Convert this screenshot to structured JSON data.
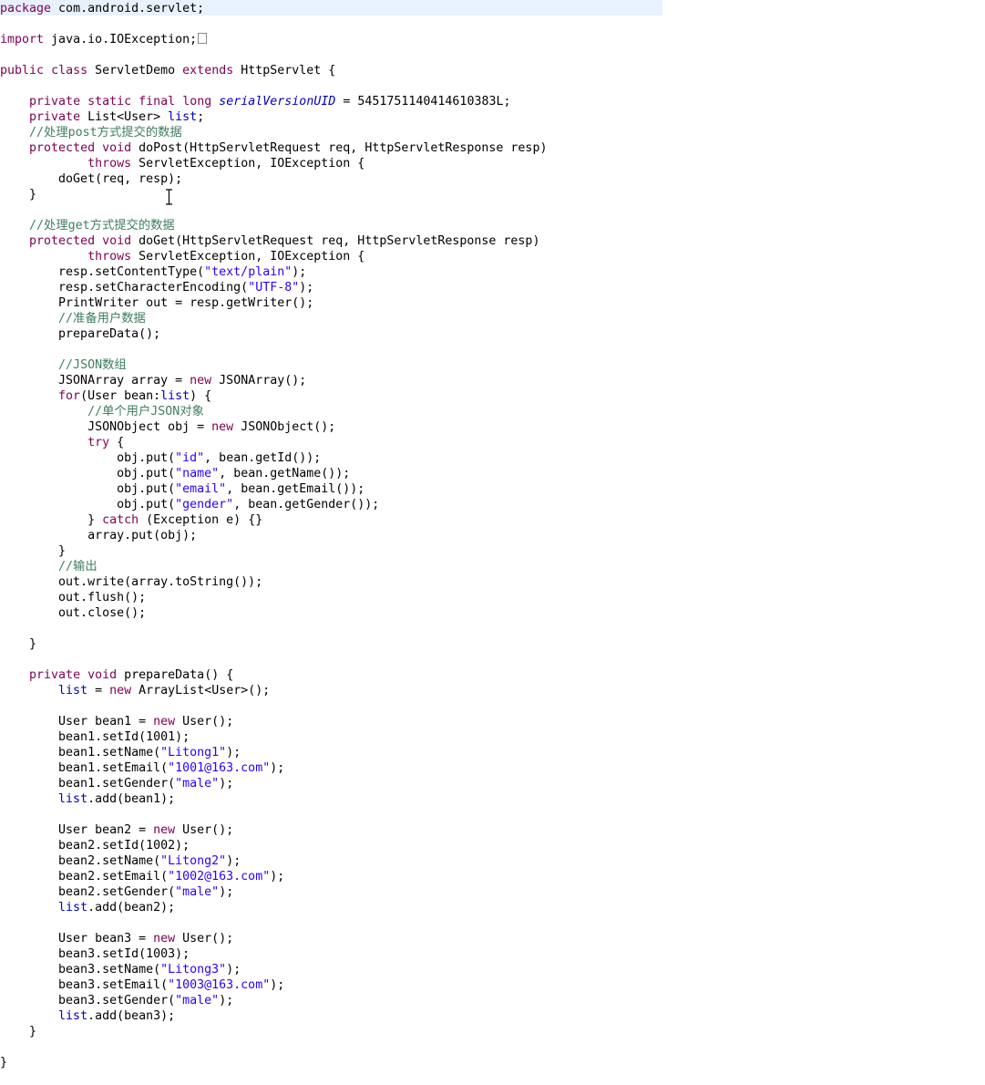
{
  "editor": {
    "lines": [
      [
        {
          "t": "package",
          "c": "kw"
        },
        {
          "t": " com.android.servlet;"
        }
      ],
      [],
      [
        {
          "t": "import",
          "c": "kw"
        },
        {
          "t": " java.io.IOException;"
        },
        {
          "fold": true
        }
      ],
      [],
      [
        {
          "t": "public",
          "c": "kw"
        },
        {
          "t": " "
        },
        {
          "t": "class",
          "c": "kw"
        },
        {
          "t": " ServletDemo "
        },
        {
          "t": "extends",
          "c": "kw"
        },
        {
          "t": " HttpServlet {"
        }
      ],
      [],
      [
        {
          "t": "    "
        },
        {
          "t": "private",
          "c": "kw"
        },
        {
          "t": " "
        },
        {
          "t": "static",
          "c": "kw"
        },
        {
          "t": " "
        },
        {
          "t": "final",
          "c": "kw"
        },
        {
          "t": " "
        },
        {
          "t": "long",
          "c": "kw"
        },
        {
          "t": " "
        },
        {
          "t": "serialVersionUID",
          "c": "field-italic"
        },
        {
          "t": " = 5451751140414610383L;"
        }
      ],
      [
        {
          "t": "    "
        },
        {
          "t": "private",
          "c": "kw"
        },
        {
          "t": " List<User> "
        },
        {
          "t": "list",
          "c": "field"
        },
        {
          "t": ";"
        }
      ],
      [
        {
          "t": "    "
        },
        {
          "t": "//处理post方式提交的数据",
          "c": "cm"
        }
      ],
      [
        {
          "t": "    "
        },
        {
          "t": "protected",
          "c": "kw"
        },
        {
          "t": " "
        },
        {
          "t": "void",
          "c": "kw"
        },
        {
          "t": " doPost(HttpServletRequest req, HttpServletResponse resp)"
        }
      ],
      [
        {
          "t": "            "
        },
        {
          "t": "throws",
          "c": "kw"
        },
        {
          "t": " ServletException, IOException {"
        }
      ],
      [
        {
          "t": "        doGet(req, resp);"
        }
      ],
      [
        {
          "t": "    }"
        }
      ],
      [],
      [
        {
          "t": "    "
        },
        {
          "t": "//处理get方式提交的数据",
          "c": "cm"
        }
      ],
      [
        {
          "t": "    "
        },
        {
          "t": "protected",
          "c": "kw"
        },
        {
          "t": " "
        },
        {
          "t": "void",
          "c": "kw"
        },
        {
          "t": " doGet(HttpServletRequest req, HttpServletResponse resp)"
        }
      ],
      [
        {
          "t": "            "
        },
        {
          "t": "throws",
          "c": "kw"
        },
        {
          "t": " ServletException, IOException {"
        }
      ],
      [
        {
          "t": "        resp.setContentType("
        },
        {
          "t": "\"text/plain\"",
          "c": "str"
        },
        {
          "t": ");"
        }
      ],
      [
        {
          "t": "        resp.setCharacterEncoding("
        },
        {
          "t": "\"UTF-8\"",
          "c": "str"
        },
        {
          "t": ");"
        }
      ],
      [
        {
          "t": "        PrintWriter out = resp.getWriter();"
        }
      ],
      [
        {
          "t": "        "
        },
        {
          "t": "//准备用户数据",
          "c": "cm"
        }
      ],
      [
        {
          "t": "        prepareData();"
        }
      ],
      [],
      [
        {
          "t": "        "
        },
        {
          "t": "//JSON数组",
          "c": "cm"
        }
      ],
      [
        {
          "t": "        JSONArray array = "
        },
        {
          "t": "new",
          "c": "kw"
        },
        {
          "t": " JSONArray();"
        }
      ],
      [
        {
          "t": "        "
        },
        {
          "t": "for",
          "c": "kw"
        },
        {
          "t": "(User bean:"
        },
        {
          "t": "list",
          "c": "field"
        },
        {
          "t": ") {"
        }
      ],
      [
        {
          "t": "            "
        },
        {
          "t": "//单个用户JSON对象",
          "c": "cm"
        }
      ],
      [
        {
          "t": "            JSONObject obj = "
        },
        {
          "t": "new",
          "c": "kw"
        },
        {
          "t": " JSONObject();"
        }
      ],
      [
        {
          "t": "            "
        },
        {
          "t": "try",
          "c": "kw"
        },
        {
          "t": " {"
        }
      ],
      [
        {
          "t": "                obj.put("
        },
        {
          "t": "\"id\"",
          "c": "str"
        },
        {
          "t": ", bean.getId());"
        }
      ],
      [
        {
          "t": "                obj.put("
        },
        {
          "t": "\"name\"",
          "c": "str"
        },
        {
          "t": ", bean.getName());"
        }
      ],
      [
        {
          "t": "                obj.put("
        },
        {
          "t": "\"email\"",
          "c": "str"
        },
        {
          "t": ", bean.getEmail());"
        }
      ],
      [
        {
          "t": "                obj.put("
        },
        {
          "t": "\"gender\"",
          "c": "str"
        },
        {
          "t": ", bean.getGender());"
        }
      ],
      [
        {
          "t": "            } "
        },
        {
          "t": "catch",
          "c": "kw"
        },
        {
          "t": " (Exception e) {}"
        }
      ],
      [
        {
          "t": "            array.put(obj);"
        }
      ],
      [
        {
          "t": "        }"
        }
      ],
      [
        {
          "t": "        "
        },
        {
          "t": "//输出",
          "c": "cm"
        }
      ],
      [
        {
          "t": "        out.write(array.toString());"
        }
      ],
      [
        {
          "t": "        out.flush();"
        }
      ],
      [
        {
          "t": "        out.close();"
        }
      ],
      [],
      [
        {
          "t": "    }"
        }
      ],
      [],
      [
        {
          "t": "    "
        },
        {
          "t": "private",
          "c": "kw"
        },
        {
          "t": " "
        },
        {
          "t": "void",
          "c": "kw"
        },
        {
          "t": " prepareData() {"
        }
      ],
      [
        {
          "t": "        "
        },
        {
          "t": "list",
          "c": "field"
        },
        {
          "t": " = "
        },
        {
          "t": "new",
          "c": "kw"
        },
        {
          "t": " ArrayList<User>();"
        }
      ],
      [],
      [
        {
          "t": "        User bean1 = "
        },
        {
          "t": "new",
          "c": "kw"
        },
        {
          "t": " User();"
        }
      ],
      [
        {
          "t": "        bean1.setId(1001);"
        }
      ],
      [
        {
          "t": "        bean1.setName("
        },
        {
          "t": "\"Litong1\"",
          "c": "str"
        },
        {
          "t": ");"
        }
      ],
      [
        {
          "t": "        bean1.setEmail("
        },
        {
          "t": "\"1001@163.com\"",
          "c": "str"
        },
        {
          "t": ");"
        }
      ],
      [
        {
          "t": "        bean1.setGender("
        },
        {
          "t": "\"male\"",
          "c": "str"
        },
        {
          "t": ");"
        }
      ],
      [
        {
          "t": "        "
        },
        {
          "t": "list",
          "c": "field"
        },
        {
          "t": ".add(bean1);"
        }
      ],
      [],
      [
        {
          "t": "        User bean2 = "
        },
        {
          "t": "new",
          "c": "kw"
        },
        {
          "t": " User();"
        }
      ],
      [
        {
          "t": "        bean2.setId(1002);"
        }
      ],
      [
        {
          "t": "        bean2.setName("
        },
        {
          "t": "\"Litong2\"",
          "c": "str"
        },
        {
          "t": ");"
        }
      ],
      [
        {
          "t": "        bean2.setEmail("
        },
        {
          "t": "\"1002@163.com\"",
          "c": "str"
        },
        {
          "t": ");"
        }
      ],
      [
        {
          "t": "        bean2.setGender("
        },
        {
          "t": "\"male\"",
          "c": "str"
        },
        {
          "t": ");"
        }
      ],
      [
        {
          "t": "        "
        },
        {
          "t": "list",
          "c": "field"
        },
        {
          "t": ".add(bean2);"
        }
      ],
      [],
      [
        {
          "t": "        User bean3 = "
        },
        {
          "t": "new",
          "c": "kw"
        },
        {
          "t": " User();"
        }
      ],
      [
        {
          "t": "        bean3.setId(1003);"
        }
      ],
      [
        {
          "t": "        bean3.setName("
        },
        {
          "t": "\"Litong3\"",
          "c": "str"
        },
        {
          "t": ");"
        }
      ],
      [
        {
          "t": "        bean3.setEmail("
        },
        {
          "t": "\"1003@163.com\"",
          "c": "str"
        },
        {
          "t": ");"
        }
      ],
      [
        {
          "t": "        bean3.setGender("
        },
        {
          "t": "\"male\"",
          "c": "str"
        },
        {
          "t": ");"
        }
      ],
      [
        {
          "t": "        "
        },
        {
          "t": "list",
          "c": "field"
        },
        {
          "t": ".add(bean3);"
        }
      ],
      [
        {
          "t": "    }"
        }
      ],
      [],
      [
        {
          "t": "}"
        }
      ]
    ]
  },
  "colors": {
    "keyword": "#7f0055",
    "string": "#2a00ff",
    "field": "#0000c0",
    "comment": "#3f7f5f",
    "current_line": "#e8f2fe",
    "background": "#ffffff"
  },
  "icons": {
    "cursor": "text-cursor-icon",
    "fold": "collapsed-fold-icon"
  }
}
